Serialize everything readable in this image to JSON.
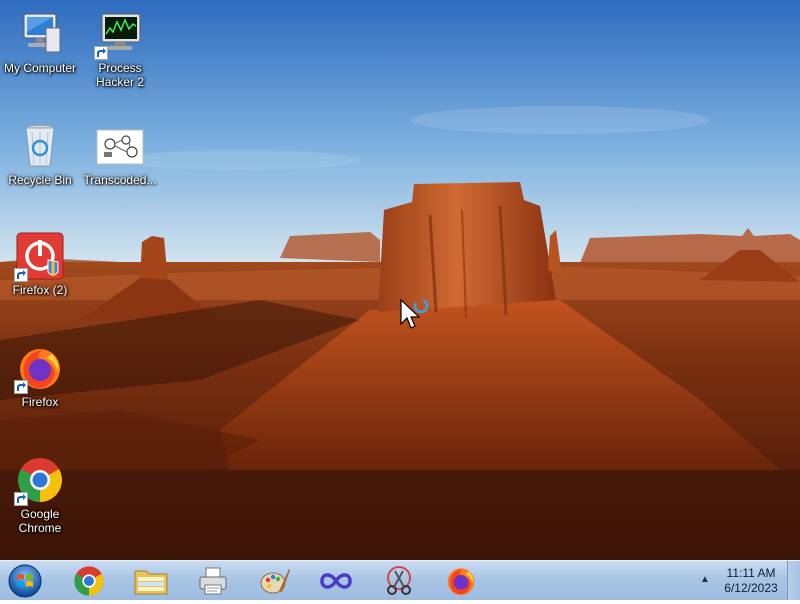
{
  "desktop": {
    "icons": [
      {
        "label": "My Computer"
      },
      {
        "label": "Process Hacker 2"
      },
      {
        "label": "Recycle Bin"
      },
      {
        "label": "Transcoded..."
      },
      {
        "label": "Firefox (2)"
      },
      {
        "label": "Firefox"
      },
      {
        "label": "Google Chrome"
      }
    ]
  },
  "taskbar": {
    "start": "start-orb-icon",
    "pinned": [
      "chrome-icon",
      "folder-icon",
      "printer-icon",
      "paint-icon",
      "infinity-app-icon",
      "scissors-tool-icon",
      "firefox-icon"
    ],
    "tray_chevron": "▲",
    "clock": {
      "time": "11:11 AM",
      "date": "6/12/2023"
    }
  },
  "colors": {
    "sky_top": "#2f6fc1",
    "sky_horizon": "#cfe3f3",
    "rock": "#b8501e",
    "taskbar": "#a9c5e6"
  }
}
